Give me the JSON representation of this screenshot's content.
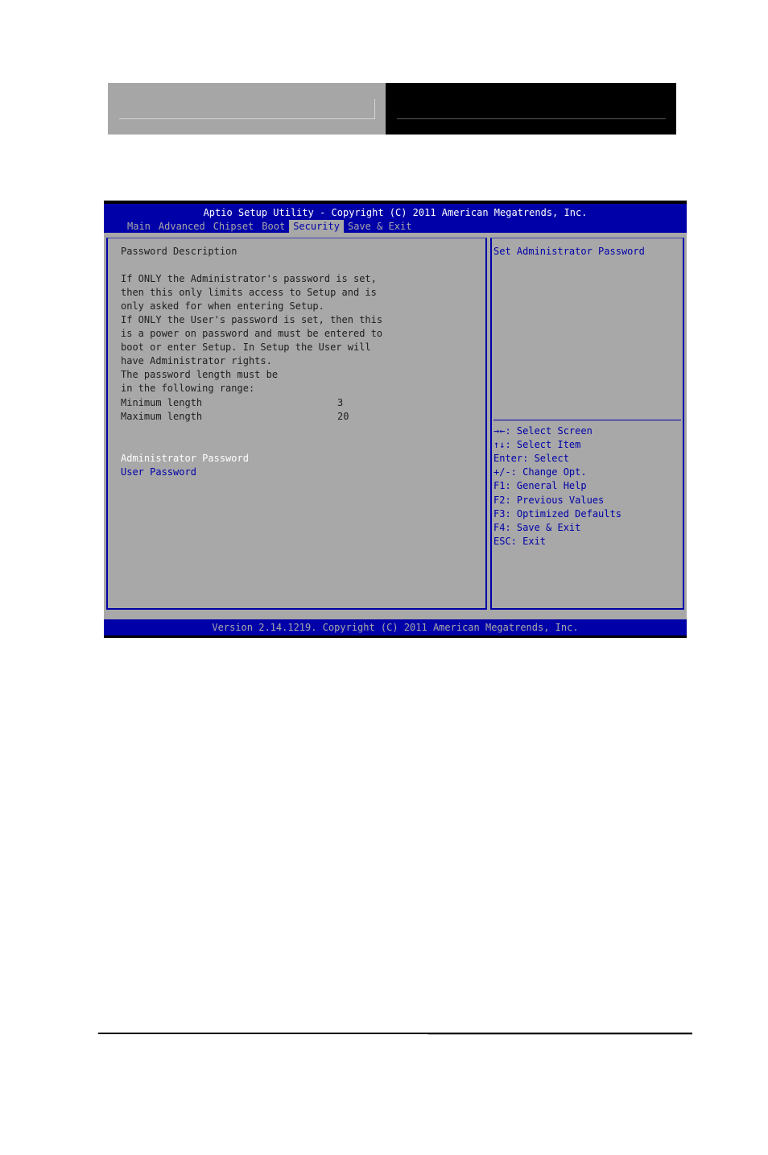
{
  "header": {
    "left_panel_color": "#a6a6a6",
    "right_panel_color": "#000000"
  },
  "bios": {
    "title": "Aptio Setup Utility - Copyright (C) 2011 American Megatrends, Inc.",
    "tabs": [
      {
        "label": "Main",
        "active": false
      },
      {
        "label": "Advanced",
        "active": false
      },
      {
        "label": "Chipset",
        "active": false
      },
      {
        "label": "Boot",
        "active": false
      },
      {
        "label": "Security",
        "active": true
      },
      {
        "label": "Save & Exit",
        "active": false
      }
    ],
    "description": {
      "heading": "Password Description",
      "lines": [
        "If ONLY the Administrator's password is set,",
        "then this only limits access to Setup and is",
        "only asked for when entering Setup.",
        "If ONLY the User's password is set, then this",
        "is a power on password and must be entered to",
        "boot or enter Setup. In Setup the User will",
        "have Administrator rights.",
        "The password length must be",
        "in the following range:"
      ],
      "min_label": "Minimum length",
      "min_value": "3",
      "max_label": "Maximum length",
      "max_value": "20"
    },
    "items": [
      {
        "label": "Administrator Password",
        "selected": true
      },
      {
        "label": "User Password",
        "selected": false
      }
    ],
    "help_text": "Set Administrator Password",
    "keys": [
      "→←: Select Screen",
      "↑↓: Select Item",
      "Enter: Select",
      "+/-: Change Opt.",
      "F1: General Help",
      "F2: Previous Values",
      "F3: Optimized Defaults",
      "F4: Save & Exit",
      "ESC: Exit"
    ],
    "version": "Version 2.14.1219. Copyright (C) 2011 American Megatrends, Inc.",
    "colors": {
      "blue": "#0000a8",
      "gray": "#a8a8a8",
      "white": "#ffffff"
    }
  }
}
